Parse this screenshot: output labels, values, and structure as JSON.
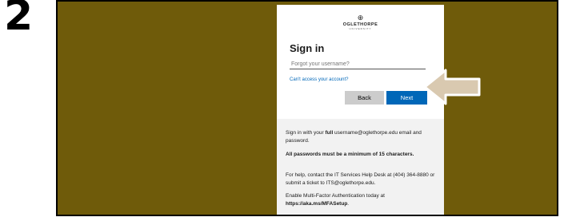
{
  "step_number": "2",
  "org": {
    "name": "OGLETHORPE",
    "subtitle": "UNIVERSITY"
  },
  "signin": {
    "title": "Sign in",
    "username_placeholder": "Forgot your username?",
    "cant_access_link": "Can't access your account?",
    "back_label": "Back",
    "next_label": "Next"
  },
  "info": {
    "p1_pre": "Sign in with your ",
    "p1_bold": "full",
    "p1_post": " username@oglethorpe.edu email and password.",
    "p2": "All passwords must be a minimum of 15 characters.",
    "p3": "For help, contact the IT Services Help Desk at (404) 364-8880 or submit a ticket to ITS@oglethorpe.edu.",
    "p4": "Enable Multi-Factor Authentication today at",
    "p4_link": "https://aka.ms/MFASetup",
    "p4_end": "."
  },
  "colors": {
    "frame_background": "#6f5b0a",
    "accent": "#0067b8",
    "arrow": "#d9c9b0"
  }
}
